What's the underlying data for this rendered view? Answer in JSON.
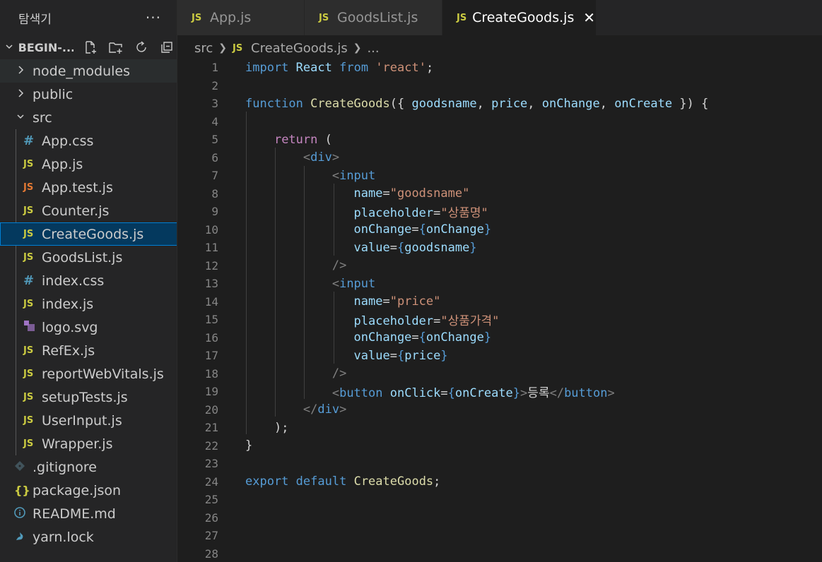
{
  "sidebar": {
    "title": "탐색기",
    "more": "···",
    "project": "BEGIN-...",
    "items": [
      {
        "label": "node_modules",
        "type": "folder",
        "expanded": false
      },
      {
        "label": "public",
        "type": "folder",
        "expanded": false
      },
      {
        "label": "src",
        "type": "folder",
        "expanded": true
      },
      {
        "label": "App.css",
        "icon": "#"
      },
      {
        "label": "App.js",
        "icon": "JS"
      },
      {
        "label": "App.test.js",
        "icon": "JS"
      },
      {
        "label": "Counter.js",
        "icon": "JS"
      },
      {
        "label": "CreateGoods.js",
        "icon": "JS"
      },
      {
        "label": "GoodsList.js",
        "icon": "JS"
      },
      {
        "label": "index.css",
        "icon": "#"
      },
      {
        "label": "index.js",
        "icon": "JS"
      },
      {
        "label": "logo.svg",
        "icon": "svg-icon"
      },
      {
        "label": "RefEx.js",
        "icon": "JS"
      },
      {
        "label": "reportWebVitals.js",
        "icon": "JS"
      },
      {
        "label": "setupTests.js",
        "icon": "JS"
      },
      {
        "label": "UserInput.js",
        "icon": "JS"
      },
      {
        "label": "Wrapper.js",
        "icon": "JS"
      },
      {
        "label": ".gitignore",
        "icon": "git-icon"
      },
      {
        "label": "package.json",
        "icon": "{}"
      },
      {
        "label": "README.md",
        "icon": "info-icon"
      },
      {
        "label": "yarn.lock",
        "icon": "yarn-icon"
      }
    ]
  },
  "tabs": [
    {
      "label": "App.js",
      "icon": "JS",
      "active": false
    },
    {
      "label": "GoodsList.js",
      "icon": "JS",
      "active": false
    },
    {
      "label": "CreateGoods.js",
      "icon": "JS",
      "active": true,
      "close": "✕"
    }
  ],
  "breadcrumb": {
    "root": "src",
    "icon": "JS",
    "file": "CreateGoods.js",
    "rest": "..."
  },
  "editor": {
    "line_numbers": [
      "1",
      "2",
      "3",
      "4",
      "5",
      "6",
      "7",
      "8",
      "9",
      "10",
      "11",
      "12",
      "13",
      "14",
      "15",
      "16",
      "17",
      "18",
      "19",
      "20",
      "21",
      "22",
      "23",
      "24",
      "25",
      "26",
      "27",
      "28"
    ],
    "lines": [
      "import React from 'react';",
      "",
      "function CreateGoods({ goodsname, price, onChange, onCreate }) {",
      "",
      "    return (",
      "        <div>",
      "            <input",
      "               name=\"goodsname\"",
      "               placeholder=\"상품명\"",
      "               onChange={onChange}",
      "               value={goodsname}",
      "            />",
      "            <input",
      "               name=\"price\"",
      "               placeholder=\"상품가격\"",
      "               onChange={onChange}",
      "               value={price}",
      "            />",
      "            <button onClick={onCreate}>등록</button>",
      "        </div>",
      "    );",
      "}",
      "",
      "export default CreateGoods;",
      "",
      "",
      "",
      ""
    ]
  }
}
